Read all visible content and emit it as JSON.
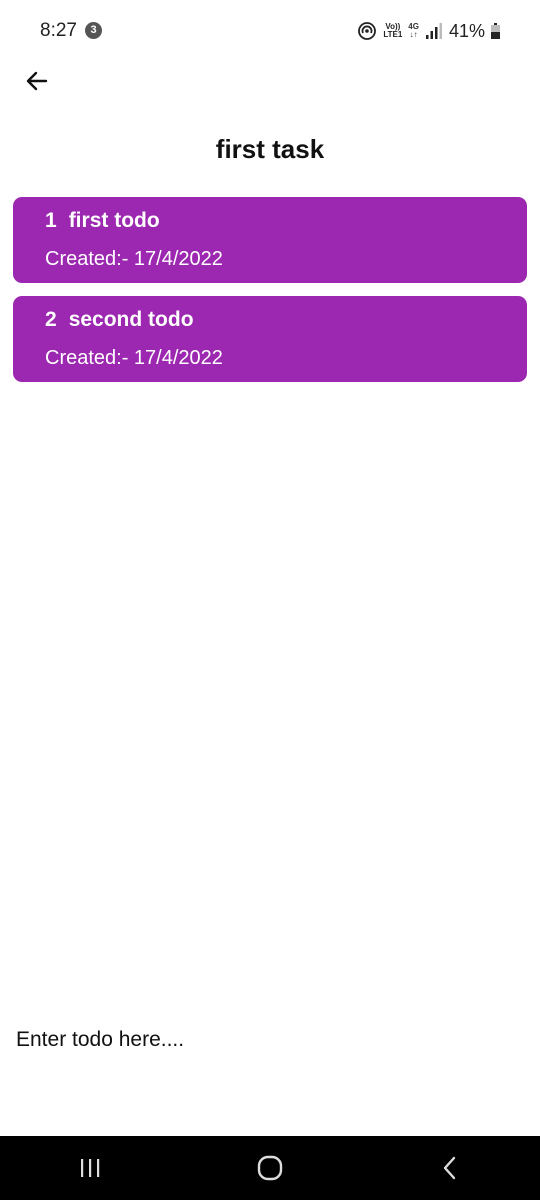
{
  "status_bar": {
    "time": "8:27",
    "notification_count": "3",
    "volte_top": "Vo))",
    "volte_bottom": "LTE1",
    "network_top": "4G",
    "network_bottom": "↓↑",
    "battery_percent": "41%"
  },
  "header": {
    "title": "first task"
  },
  "todos": [
    {
      "index": "1",
      "title": "first todo",
      "created": "Created:- 17/4/2022"
    },
    {
      "index": "2",
      "title": "second todo",
      "created": "Created:- 17/4/2022"
    }
  ],
  "input": {
    "placeholder": "Enter todo here....",
    "value": ""
  },
  "icons": {
    "back": "arrow-left-icon",
    "nav_recents": "recents-icon",
    "nav_home": "home-icon",
    "nav_back": "chevron-left-icon"
  },
  "colors": {
    "accent": "#9c27b0",
    "nav_background": "#000000"
  }
}
